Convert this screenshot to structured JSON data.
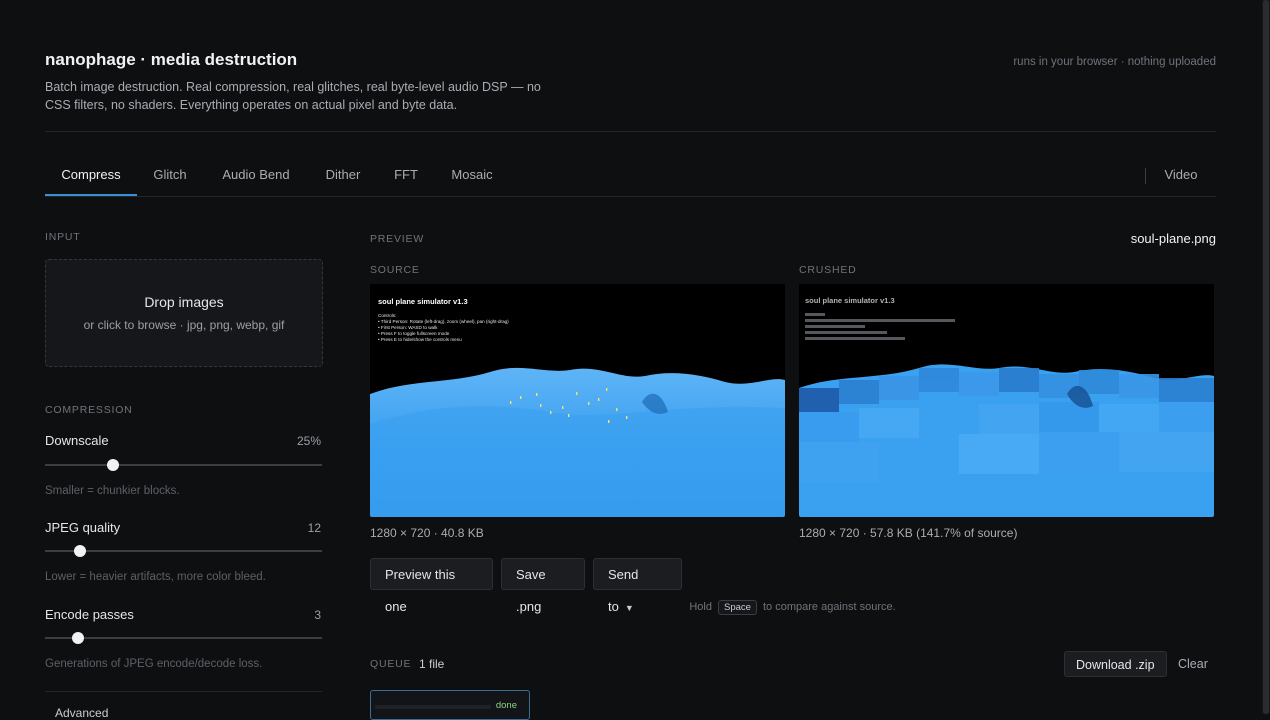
{
  "header": {
    "title": "nanophage · media destruction",
    "description": "Batch image destruction. Real compression, real glitches, real byte-level audio DSP — no CSS filters, no shaders. Everything operates on actual pixel and byte data.",
    "note": "runs in your browser · nothing uploaded"
  },
  "tabs": [
    {
      "label": "Compress",
      "active": true
    },
    {
      "label": "Glitch"
    },
    {
      "label": "Audio Bend"
    },
    {
      "label": "Dither"
    },
    {
      "label": "FFT"
    },
    {
      "label": "Mosaic"
    },
    {
      "label": "Video"
    }
  ],
  "input": {
    "section_label": "INPUT",
    "drop_title": "Drop images",
    "drop_sub": "or click to browse · jpg, png, webp, gif"
  },
  "compression": {
    "section_label": "COMPRESSION",
    "downscale": {
      "label": "Downscale",
      "value": "25%",
      "level": 0.25,
      "hint": "Smaller = chunkier blocks."
    },
    "jpeg_quality": {
      "label": "JPEG quality",
      "value": "12",
      "level": 0.12,
      "hint": "Lower = heavier artifacts, more color bleed."
    },
    "encode_passes": {
      "label": "Encode passes",
      "value": "3",
      "level": 0.12,
      "hint": "Generations of JPEG encode/decode loss."
    },
    "advanced_label": "Advanced"
  },
  "preview": {
    "section_label": "PREVIEW",
    "filename": "soul-plane.png",
    "source": {
      "label": "SOURCE",
      "meta": "1280 × 720 · 40.8 KB",
      "image_title": "soul plane simulator v1.3",
      "image_lines": [
        "Controls:",
        "• Third Person: Rotate (left-drag), zoom (wheel), pan (right-drag)",
        "• First Person: WASD to walk",
        "• Press F to toggle fullscreen mode",
        "• Press E to hide/show the controls menu"
      ]
    },
    "crushed": {
      "label": "CRUSHED",
      "meta": "1280 × 720 · 57.8 KB (141.7% of source)",
      "image_title": "soul plane simulator v1.3"
    },
    "buttons": {
      "preview_this": "Preview this one",
      "save_png": "Save .png",
      "send_to": "Send to"
    },
    "hint_before": "Hold",
    "hint_key": "Space",
    "hint_after": "to compare against source."
  },
  "queue": {
    "section_label": "QUEUE",
    "count": "1 file",
    "download_zip": "Download .zip",
    "clear": "Clear",
    "items": [
      {
        "status": "done"
      }
    ]
  },
  "colors": {
    "accent": "#3a8fd9",
    "terrain": "#3aa0f0",
    "done": "#8bd37a"
  }
}
